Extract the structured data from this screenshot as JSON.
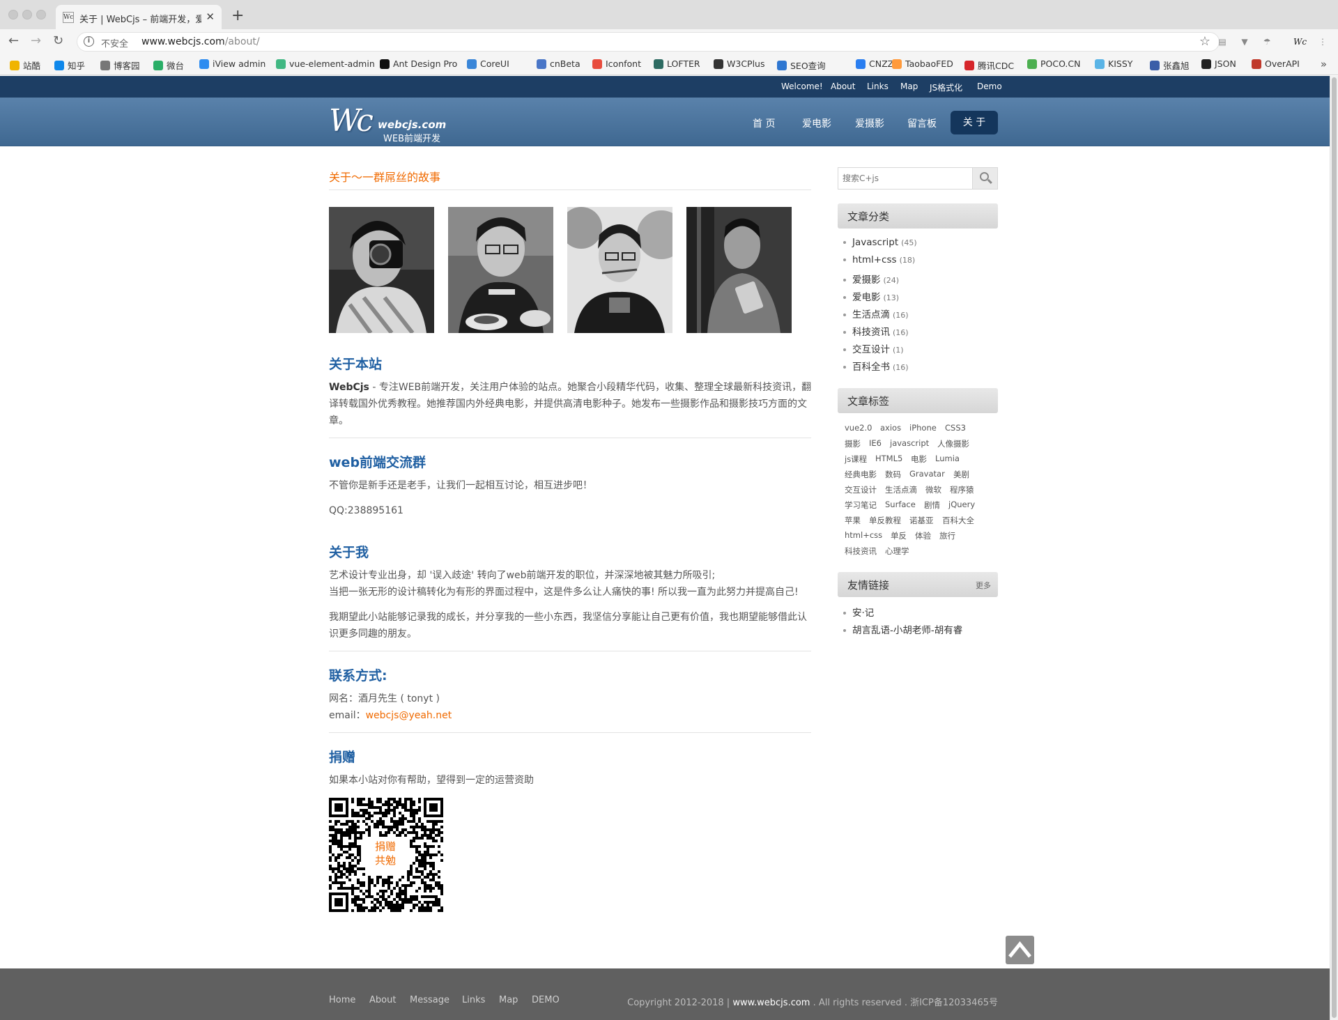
{
  "browser": {
    "tab_title": "关于 | WebCjs – 前端开发，爱摄影",
    "tab_favicon": "Wc",
    "security_label": "不安全",
    "url_host": "www.webcjs.com",
    "url_path": "/about/",
    "bookmarks": [
      {
        "label": "站酷",
        "icon": "zcool-icon",
        "color": "#f0b400"
      },
      {
        "label": "知乎",
        "icon": "zhihu-icon",
        "color": "#0f88eb"
      },
      {
        "label": "博客园",
        "icon": "cnblogs-icon",
        "color": "#777"
      },
      {
        "label": "微台",
        "icon": "wechat-icon",
        "color": "#2aae67"
      },
      {
        "label": "iView admin",
        "icon": "iview-icon",
        "color": "#2d8cf0"
      },
      {
        "label": "vue-element-admin",
        "icon": "vue-icon",
        "color": "#41b883"
      },
      {
        "label": "Ant Design Pro",
        "icon": "antdesign-icon",
        "color": "#111"
      },
      {
        "label": "CoreUI",
        "icon": "coreui-icon",
        "color": "#3a86d8"
      },
      {
        "label": "cnBeta",
        "icon": "cnbeta-icon",
        "color": "#4a76c7"
      },
      {
        "label": "Iconfont",
        "icon": "iconfont-icon",
        "color": "#e84c3d"
      },
      {
        "label": "LOFTER",
        "icon": "lofter-icon",
        "color": "#2d6b62"
      },
      {
        "label": "W3CPlus",
        "icon": "w3cplus-icon",
        "color": "#333"
      },
      {
        "label": "SEO查询",
        "icon": "seo-icon",
        "color": "#2f77d1"
      },
      {
        "label": "CNZZ",
        "icon": "cnzz-icon",
        "color": "#2a7ef0"
      },
      {
        "label": "TaobaoFED",
        "icon": "taobaofed-icon",
        "color": "#ff9a3c"
      },
      {
        "label": "腾讯CDC",
        "icon": "tencentcdc-icon",
        "color": "#d6262b"
      },
      {
        "label": "POCO.CN",
        "icon": "poco-icon",
        "color": "#4caf50"
      },
      {
        "label": "KISSY",
        "icon": "kissy-icon",
        "color": "#5ab4e6"
      },
      {
        "label": "张鑫旭",
        "icon": "zhangxinxu-icon",
        "color": "#3b5ea8"
      },
      {
        "label": "JSON",
        "icon": "json-icon",
        "color": "#222"
      },
      {
        "label": "OverAPI",
        "icon": "overapi-icon",
        "color": "#c0392b"
      }
    ]
  },
  "site": {
    "top_links": [
      "Welcome!",
      "About",
      "Links",
      "Map",
      "JS格式化",
      "Demo"
    ],
    "logo_mark": "Wc",
    "logo_name": "webcjs.com",
    "logo_sub": "WEB前端开发",
    "nav": [
      "首 页",
      "爱电影",
      "爱摄影",
      "留言板"
    ],
    "nav_active": "关 于",
    "page_title": "关于～一群屌丝的故事",
    "sections": {
      "about_site": {
        "heading": "关于本站",
        "brand": "WebCjs",
        "text": " - 专注WEB前端开发，关注用户体验的站点。她聚合小段精华代码，收集、整理全球最新科技资讯，翻译转载国外优秀教程。她推荐国内外经典电影，并提供高清电影种子。她发布一些摄影作品和摄影技巧方面的文章。"
      },
      "group": {
        "heading": "web前端交流群",
        "text": "不管你是新手还是老手，让我们一起相互讨论，相互进步吧！",
        "qq": "QQ:238895161"
      },
      "about_me": {
        "heading": "关于我",
        "line1": "艺术设计专业出身，却 '误入歧途' 转向了web前端开发的职位，并深深地被其魅力所吸引;",
        "line2": "当把一张无形的设计稿转化为有形的界面过程中，这是件多么让人痛快的事! 所以我一直为此努力并提高自己!",
        "para2": "我期望此小站能够记录我的成长，并分享我的一些小东西，我坚信分享能让自己更有价值，我也期望能够借此认识更多同趣的朋友。"
      },
      "contact": {
        "heading": "联系方式:",
        "name_line": "网名：酒月先生 ( tonyt )",
        "email_label": "email：",
        "email": "webcjs@yeah.net"
      },
      "donate": {
        "heading": "捐赠",
        "text": "如果本小站对你有帮助，望得到一定的运营资助",
        "qr_line1": "捐赠",
        "qr_line2": "共勉"
      }
    },
    "sidebar": {
      "search_placeholder": "搜索C+js",
      "categories_title": "文章分类",
      "categories": [
        {
          "name": "Javascript",
          "count": "(45)"
        },
        {
          "name": "html+css",
          "count": "(18)"
        },
        {
          "name": "爱摄影",
          "count": "(24)"
        },
        {
          "name": "爱电影",
          "count": "(13)"
        },
        {
          "name": "生活点滴",
          "count": "(16)"
        },
        {
          "name": "科技资讯",
          "count": "(16)"
        },
        {
          "name": "交互设计",
          "count": "(1)"
        },
        {
          "name": "百科全书",
          "count": "(16)"
        }
      ],
      "tags_title": "文章标签",
      "tag_rows": [
        [
          "vue2.0",
          "axios",
          "iPhone",
          "CSS3"
        ],
        [
          "摄影",
          "IE6",
          "javascript",
          "人像摄影"
        ],
        [
          "js课程",
          "HTML5",
          "电影",
          "Lumia"
        ],
        [
          "经典电影",
          "数码",
          "Gravatar",
          "美剧"
        ],
        [
          "交互设计",
          "生活点滴",
          "微软",
          "程序猿"
        ],
        [
          "学习笔记",
          "Surface",
          "剧情",
          "jQuery"
        ],
        [
          "苹果",
          "单反教程",
          "诺基亚",
          "百科大全"
        ],
        [
          "html+css",
          "单反",
          "体验",
          "旅行"
        ],
        [
          "科技资讯",
          "心理学"
        ]
      ],
      "links_title": "友情链接",
      "links_more": "更多",
      "links": [
        "安·记",
        "胡言乱语-小胡老师-胡有睿"
      ]
    },
    "footer": {
      "links": [
        "Home",
        "About",
        "Message",
        "Links",
        "Map",
        "DEMO"
      ],
      "copyright_prefix": "Copyright 2012-2018 | ",
      "copyright_domain": "www.webcjs.com",
      "copyright_suffix": " . All rights reserved . 浙ICP备12033465号"
    }
  }
}
